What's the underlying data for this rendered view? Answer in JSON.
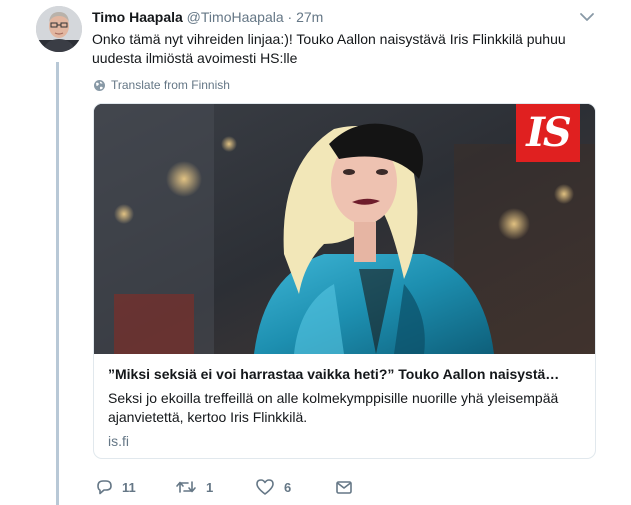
{
  "tweet": {
    "display_name": "Timo Haapala",
    "handle": "@TimoHaapala",
    "separator": "·",
    "time": "27m",
    "text": "Onko tämä nyt vihreiden linjaa:)! Touko Aallon naisystävä Iris Flinkkilä puhuu uudesta ilmiöstä avoimesti HS:lle",
    "translate_label": "Translate from Finnish"
  },
  "card": {
    "logo_text": "IS",
    "title": "”Miksi seksiä ei voi harrastaa vaikka heti?” Touko Aallon naisystä…",
    "description": "Seksi jo ekoilla treffeillä on alle kolmekymppisille nuorille yhä yleisempää ajanvietettä, kertoo Iris Flinkkilä.",
    "domain": "is.fi"
  },
  "actions": {
    "replies": "11",
    "retweets": "1",
    "likes": "6"
  },
  "colors": {
    "thread_line": "#b8c8d6",
    "secondary_text": "#657786",
    "logo_red": "#e02020"
  },
  "icons": [
    "globe-icon",
    "chevron-down-icon",
    "reply-icon",
    "retweet-icon",
    "like-icon",
    "direct-message-icon"
  ]
}
